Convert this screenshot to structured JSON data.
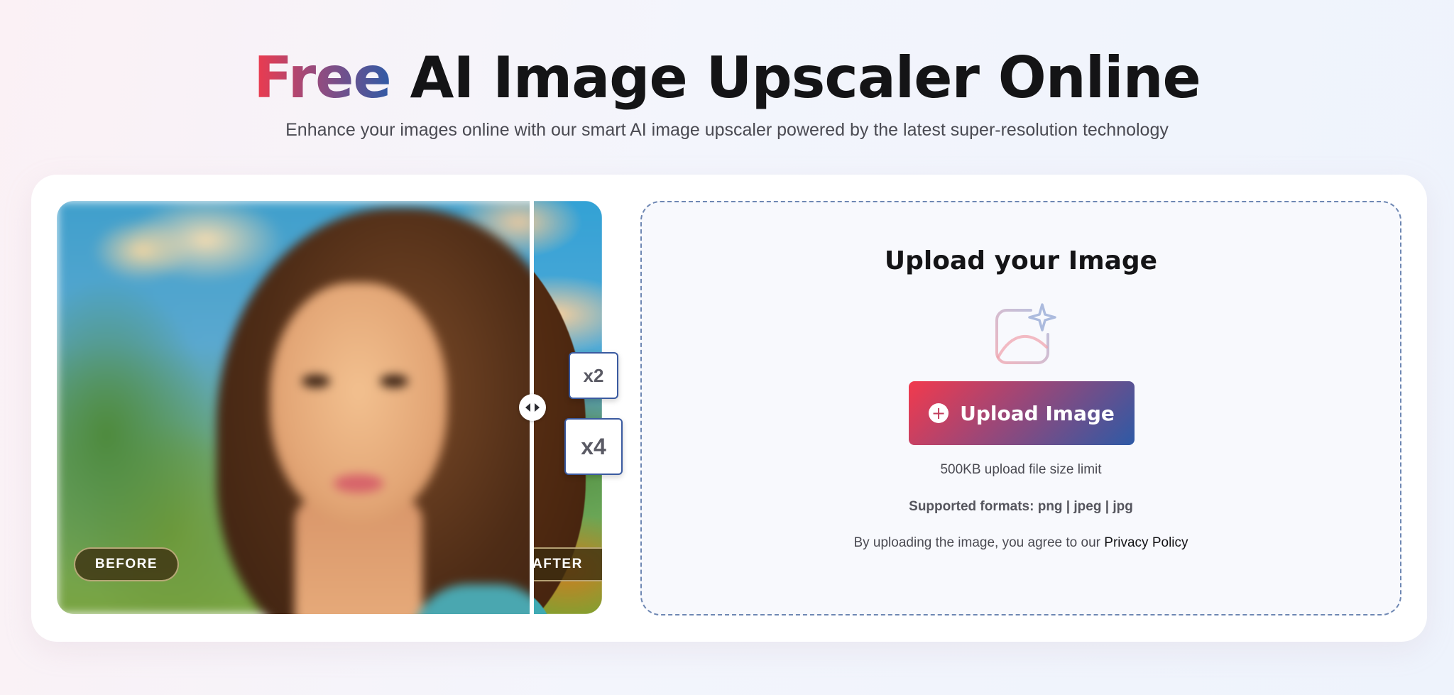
{
  "hero": {
    "title_highlight": "Free",
    "title_rest": " AI Image Upscaler Online",
    "subtitle": "Enhance your images online with our smart AI image upscaler powered by the latest super-resolution technology"
  },
  "comparison": {
    "before_label": "BEFORE",
    "after_label": "AFTER",
    "scale_options": [
      "x2",
      "x4"
    ],
    "handle_icon": "compare-arrows-icon"
  },
  "upload": {
    "title": "Upload your Image",
    "illustration_icon": "image-sparkle-icon",
    "button_icon": "plus-circle-icon",
    "button_label": "Upload Image",
    "size_limit": "500KB upload file size limit",
    "formats": "Supported formats: png | jpeg | jpg",
    "agree_prefix": "By uploading the image, you agree to our ",
    "privacy_link": "Privacy Policy"
  },
  "colors": {
    "brand_red": "#f23a4d",
    "brand_blue": "#2d5aa6",
    "dashed_border": "#6e87b3"
  }
}
